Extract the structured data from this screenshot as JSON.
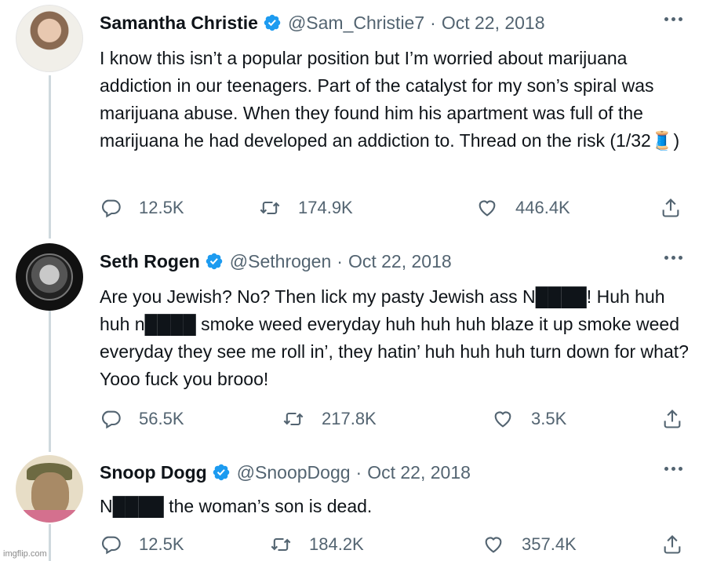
{
  "tweets": [
    {
      "name": "Samantha Christie",
      "handle": "@Sam_Christie7",
      "separator": "·",
      "date": "Oct 22, 2018",
      "text": "I know this isn’t a popular position but I’m worried about marijuana addiction in our teenagers. Part of the catalyst for my son’s spiral was marijuana abuse. When they found him his apartment was full of the marijuana he had developed an addiction to. Thread on the risk (1/32🧵)",
      "replies": "12.5K",
      "retweets": "174.9K",
      "likes": "446.4K"
    },
    {
      "name": "Seth Rogen",
      "handle": "@Sethrogen",
      "separator": "·",
      "date": "Oct 22, 2018",
      "text": "Are you Jewish? No? Then lick my pasty Jewish ass N████! Huh huh huh n████ smoke weed everyday huh huh huh blaze it up smoke weed everyday they see me roll in’, they hatin’ huh huh huh turn down for what? Yooo fuck you brooo!",
      "replies": "56.5K",
      "retweets": "217.8K",
      "likes": "3.5K"
    },
    {
      "name": "Snoop Dogg",
      "handle": "@SnoopDogg",
      "separator": "·",
      "date": "Oct 22, 2018",
      "text": "N████ the woman’s son is dead.",
      "replies": "12.5K",
      "retweets": "184.2K",
      "likes": "357.4K"
    }
  ],
  "watermark": "imgflip.com",
  "colors": {
    "verified": "#1d9bf0",
    "secondary_text": "#536471",
    "thread_line": "#cfd9de"
  }
}
